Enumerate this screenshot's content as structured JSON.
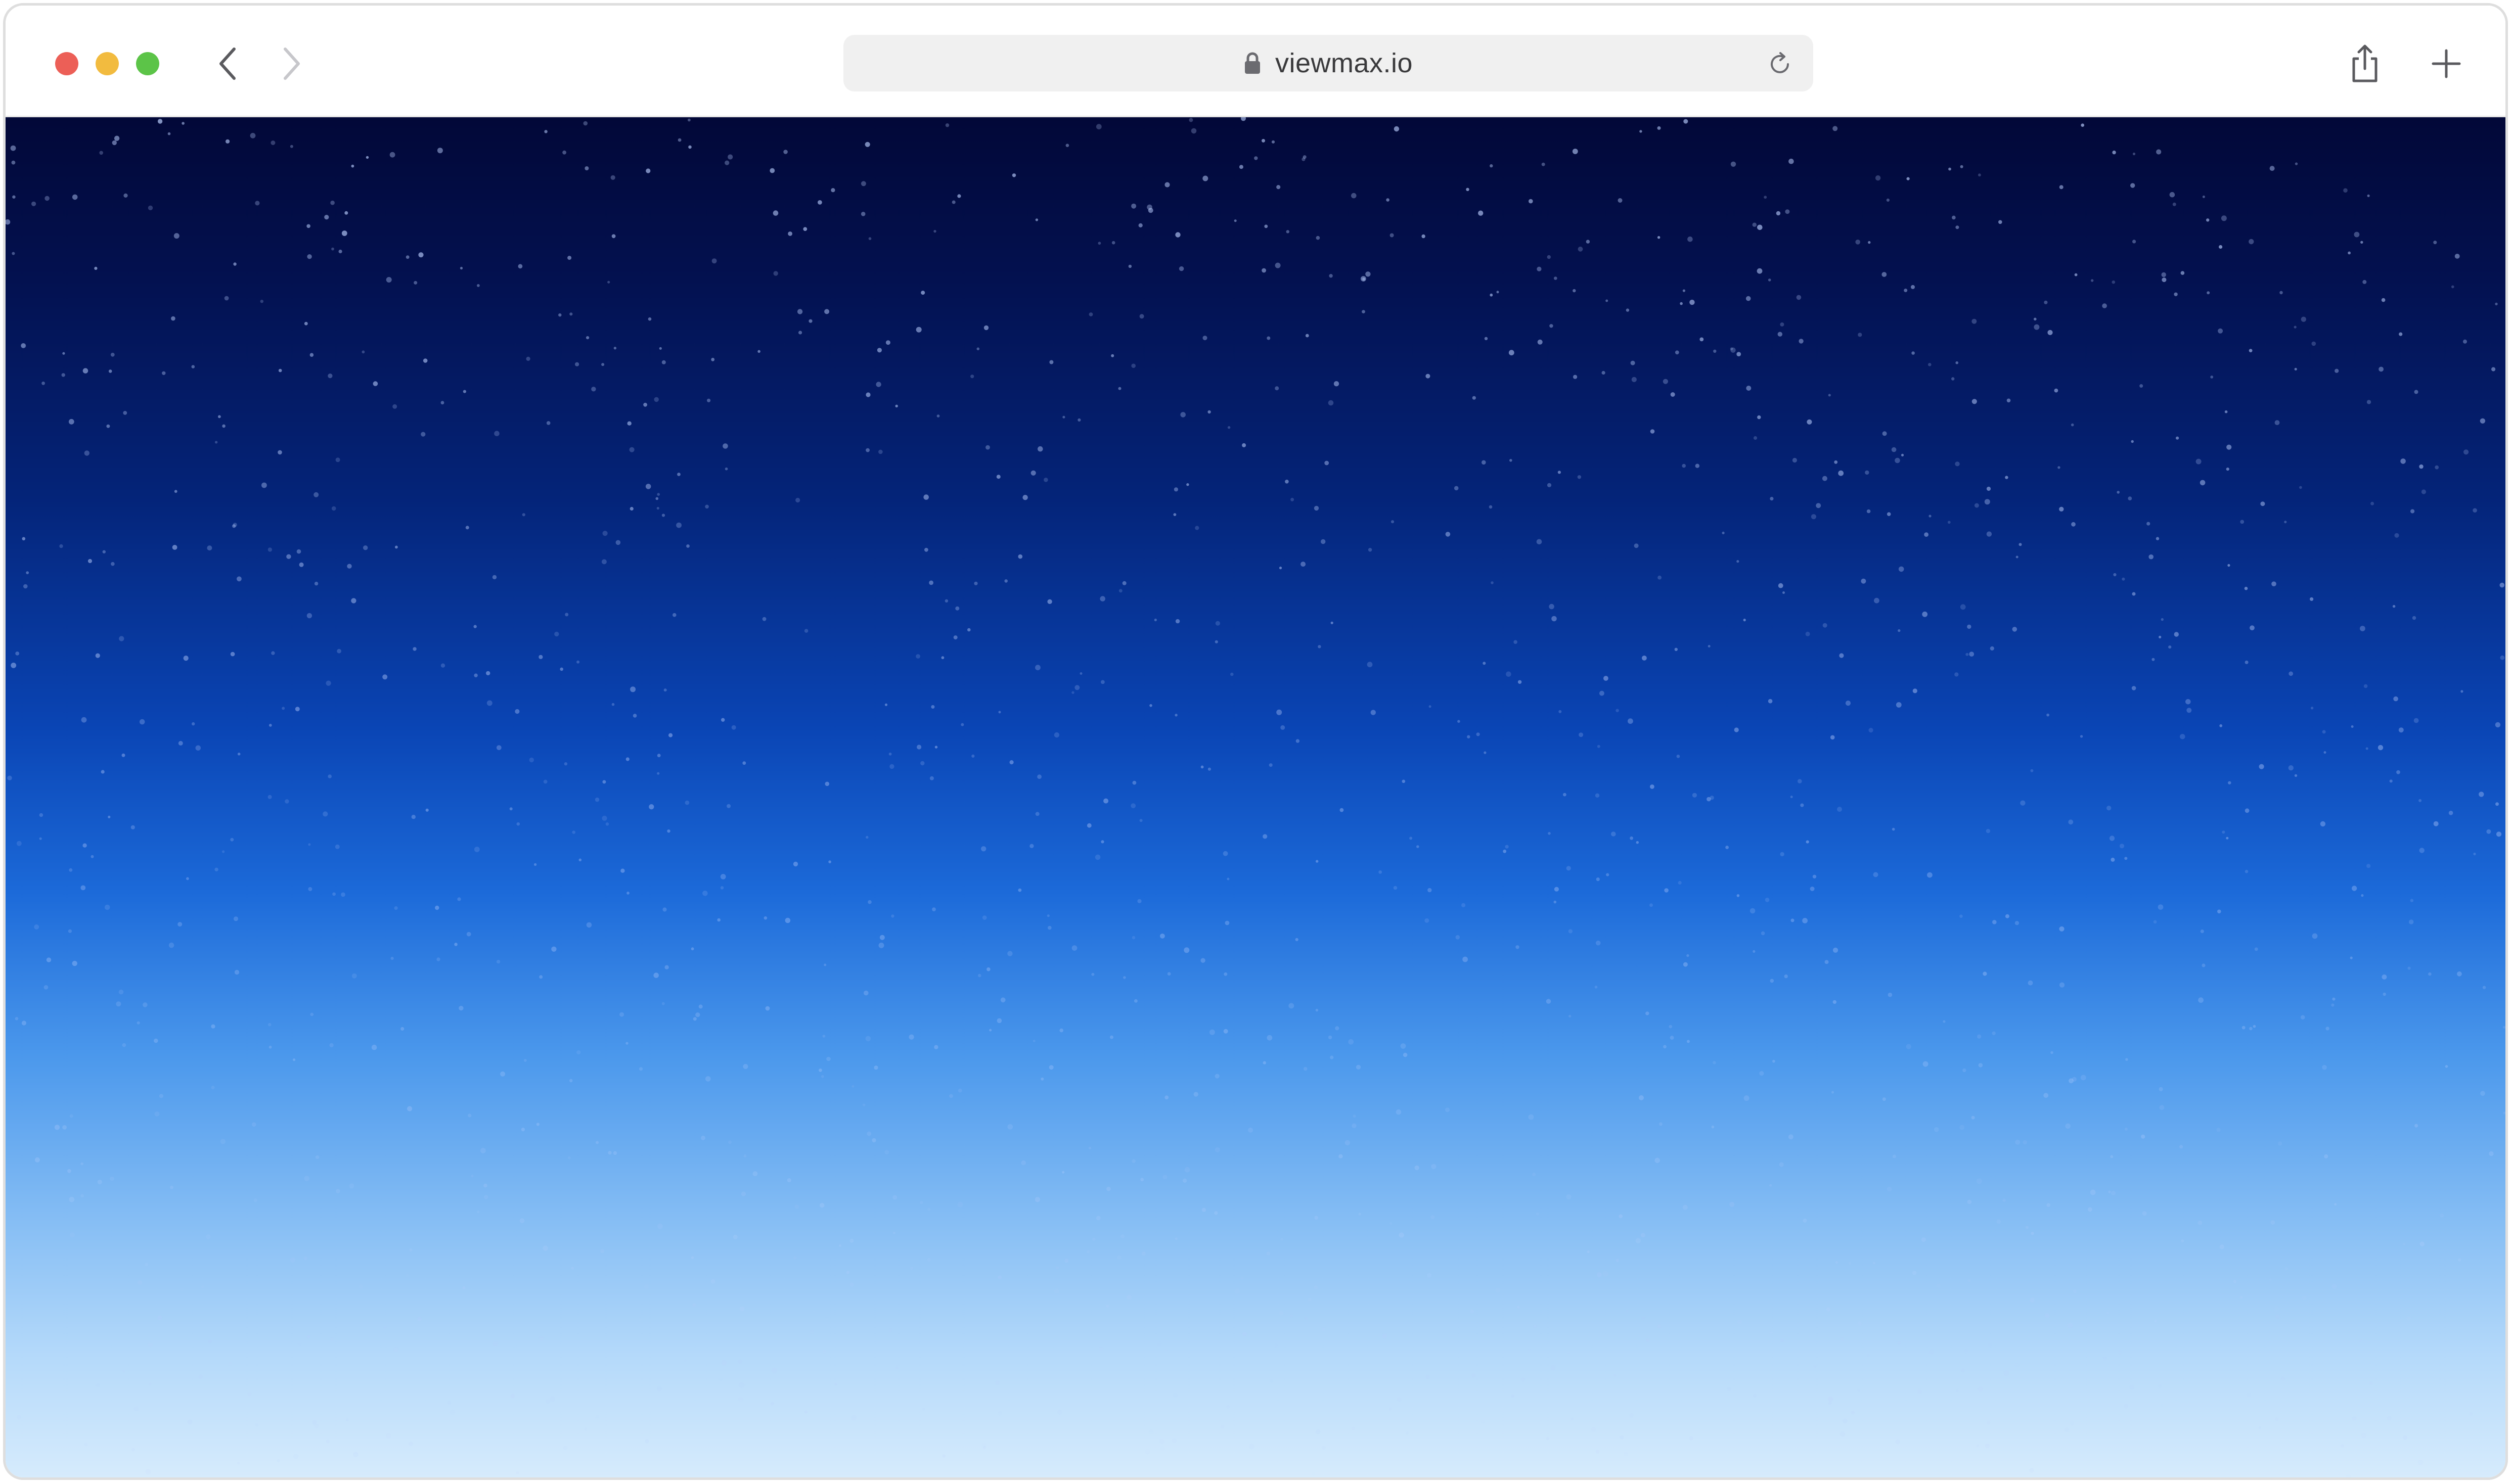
{
  "window": {
    "controls": {
      "close_color": "#ec5f57",
      "minimize_color": "#f2bb3f",
      "zoom_color": "#5cc448"
    }
  },
  "toolbar": {
    "back_icon": "chevron-left-icon",
    "forward_icon": "chevron-right-icon",
    "address": {
      "url": "viewmax.io",
      "lock_icon": "lock-icon",
      "reload_icon": "reload-icon"
    },
    "share_icon": "share-icon",
    "new_tab_icon": "plus-icon"
  },
  "page": {
    "background": "night-sky-gradient-with-stars",
    "colors": {
      "top": "#020838",
      "middle": "#0a45b5",
      "bottom": "#d6ebfc"
    }
  }
}
